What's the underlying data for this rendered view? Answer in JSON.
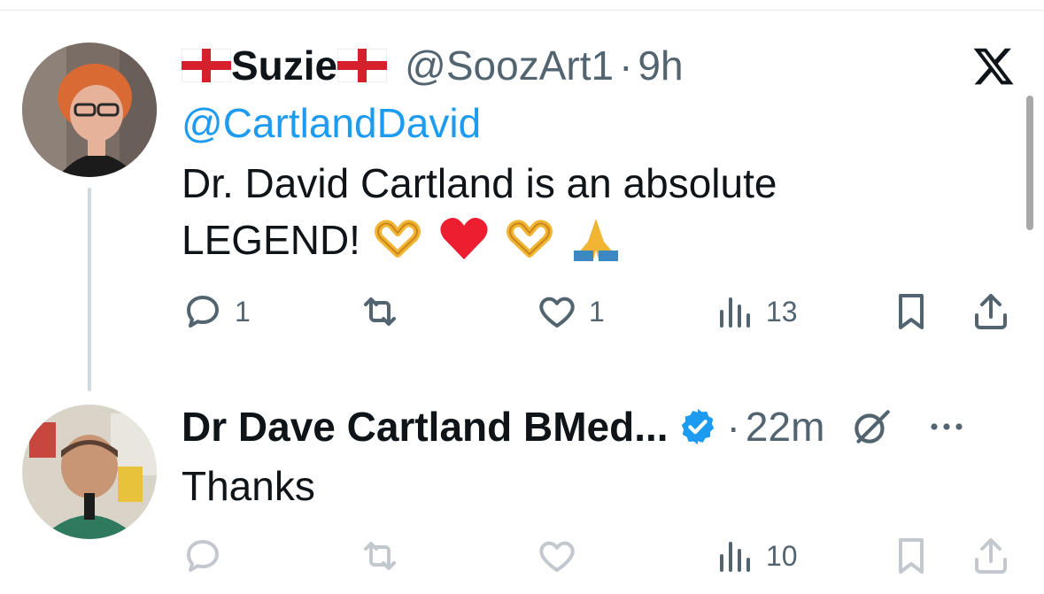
{
  "tweet1": {
    "display_name": "Suzie",
    "handle": "@SoozArt1",
    "separator": "·",
    "time": "9h",
    "mention": "@CartlandDavid",
    "text_line1": "Dr. David Cartland is an absolute",
    "text_line2": "LEGEND!",
    "emojis": [
      "heart-hands",
      "red-heart",
      "heart-hands",
      "folded-hands"
    ],
    "actions": {
      "reply_count": "1",
      "retweet_count": "",
      "like_count": "1",
      "views_count": "13"
    }
  },
  "tweet2": {
    "display_name": "Dr Dave Cartland BMed...",
    "verified": true,
    "separator": "·",
    "time": "22m",
    "text": "Thanks",
    "actions": {
      "reply_count": "",
      "retweet_count": "",
      "like_count": "",
      "views_count": "10"
    }
  },
  "colors": {
    "link": "#1d9bf0",
    "muted": "#536471",
    "text": "#0f1419",
    "heart": "#e0245e",
    "verified": "#1d9bf0"
  },
  "icons": [
    "x-logo-icon",
    "reply-icon",
    "retweet-icon",
    "like-icon",
    "views-icon",
    "bookmark-icon",
    "share-icon",
    "verified-badge-icon",
    "grok-icon",
    "more-icon"
  ]
}
